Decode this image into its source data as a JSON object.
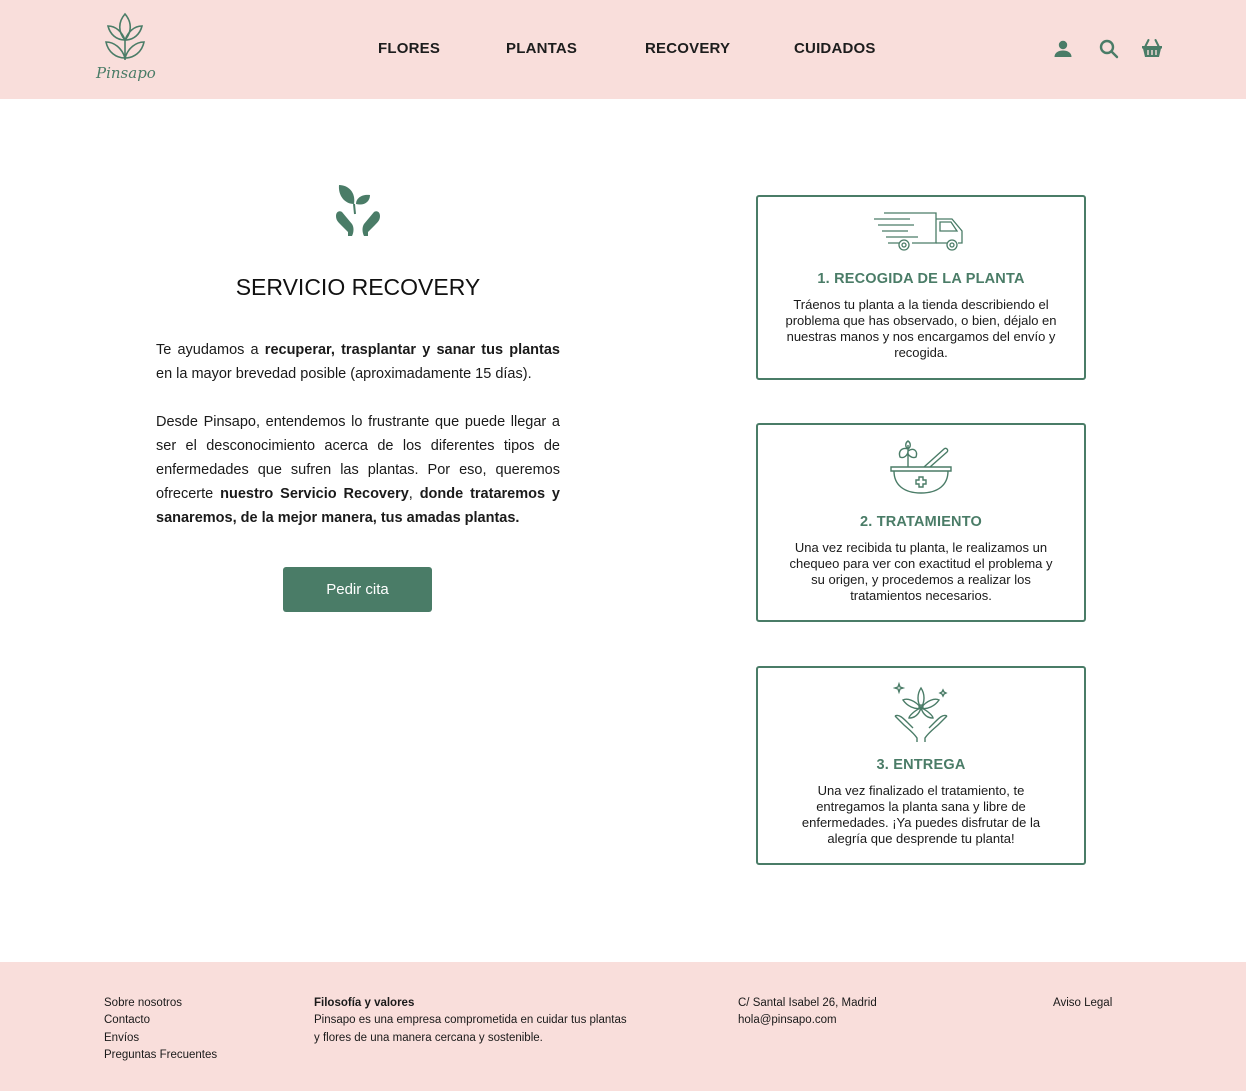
{
  "brand": {
    "logo_text": "Pinsapo",
    "accent_color": "#4a7c67",
    "header_bg": "#f9dedb"
  },
  "nav": {
    "items": [
      "FLORES",
      "PLANTAS",
      "RECOVERY",
      "CUIDADOS"
    ]
  },
  "header_icons": [
    "user-icon",
    "search-icon",
    "basket-icon"
  ],
  "intro": {
    "icon": "plant-in-hands-icon",
    "title": "SERVICIO RECOVERY",
    "p1_a": "Te ayudamos a ",
    "p1_b": "recuperar, trasplantar y sanar tus plantas",
    "p1_c": " en la mayor brevedad posible (aproximadamente 15 días).",
    "p2_a": "Desde Pinsapo, entendemos lo frustrante que puede llegar a ser el desconocimiento acerca de los diferentes tipos de enfermedades que sufren las plantas. Por eso, queremos ofrecerte ",
    "p2_b": "nuestro Servicio Recovery",
    "p2_c": ", ",
    "p2_d": "donde trataremos y sanaremos, de la mejor manera, tus amadas plantas.",
    "button": "Pedir cita"
  },
  "steps": [
    {
      "icon": "delivery-truck-icon",
      "title": "1. RECOGIDA DE LA PLANTA",
      "text": "Tráenos tu planta a la tienda describiendo el problema que has observado, o bien, déjalo en nuestras manos y nos encargamos del envío y recogida."
    },
    {
      "icon": "mortar-plant-icon",
      "title": "2. TRATAMIENTO",
      "text": "Una vez recibida tu planta, le realizamos un chequeo para ver con exactitud el problema y su origen, y procedemos a realizar los tratamientos necesarios."
    },
    {
      "icon": "flower-in-hands-icon",
      "title": "3. ENTREGA",
      "text": "Una vez finalizado el tratamiento, te entregamos la planta sana y libre de enfermedades. ¡Ya puedes disfrutar de la alegría que desprende tu planta!"
    }
  ],
  "footer": {
    "links": [
      "Sobre nosotros",
      "Contacto",
      "Envíos",
      "Preguntas Frecuentes"
    ],
    "philosophy_title": "Filosofía y valores",
    "philosophy_text_1": "Pinsapo es una empresa comprometida en cuidar tus plantas",
    "philosophy_text_2": "y flores de una manera cercana y sostenible.",
    "address": "C/ Santal Isabel 26, Madrid",
    "email": "hola@pinsapo.com",
    "legal": "Aviso Legal"
  }
}
